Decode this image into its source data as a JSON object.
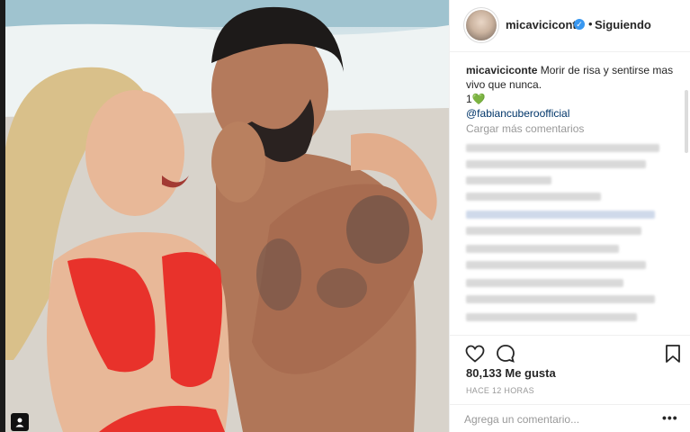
{
  "post": {
    "image_alt": "",
    "tag_icon": "person-tag-icon"
  },
  "header": {
    "username": "micaviciconte",
    "verified_icon": "verified-badge-icon",
    "separator": "•",
    "follow_status": "Siguiendo"
  },
  "caption": {
    "username": "micaviciconte",
    "text": "Morir de risa y sentirse mas vivo que nunca.",
    "line2_prefix": "1",
    "emoji": "💚",
    "mention": "@fabiancuberoofficial"
  },
  "comments": {
    "load_more": "Cargar más comentarios"
  },
  "actions": {
    "like_icon": "heart-icon",
    "comment_icon": "comment-bubble-icon",
    "save_icon": "bookmark-icon"
  },
  "likes": {
    "count_text": "80,133 Me gusta"
  },
  "timestamp": "HACE 12 HORAS",
  "add_comment": {
    "placeholder": "Agrega un comentario...",
    "more_label": "•••"
  },
  "colors": {
    "link": "#003569",
    "muted": "#999999",
    "text": "#262626",
    "verified": "#3897f0",
    "swimsuit": "#e8322b"
  }
}
